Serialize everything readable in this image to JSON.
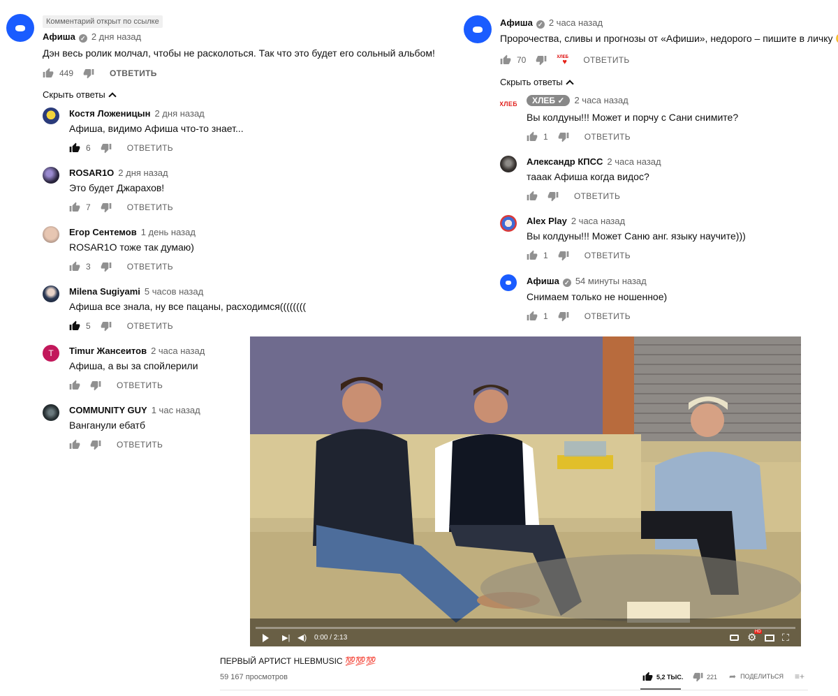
{
  "left": {
    "pinned_tag": "Комментарий открыт по ссылке",
    "main": {
      "author": "Афиша",
      "time": "2 дня назад",
      "text": "Дэн весь ролик молчал, чтобы не расколоться. Так что это будет его сольный альбом!",
      "likes": "449",
      "reply": "ОТВЕТИТЬ"
    },
    "hide_replies": "Скрыть ответы",
    "replies": [
      {
        "author": "Костя Ложеницын",
        "time": "2 дня назад",
        "text": "Афиша, видимо Афиша что-то знает...",
        "likes": "6",
        "reply": "ОТВЕТИТЬ"
      },
      {
        "author": "ROSAR1O",
        "time": "2 дня назад",
        "text": "Это будет Джарахов!",
        "likes": "7",
        "reply": "ОТВЕТИТЬ"
      },
      {
        "author": "Егор Сентемов",
        "time": "1 день назад",
        "text": "ROSAR1O тоже так думаю)",
        "likes": "3",
        "reply": "ОТВЕТИТЬ"
      },
      {
        "author": "Milena Sugiyami",
        "time": "5 часов назад",
        "text": "Афиша все знала, ну все пацаны, расходимся((((((((",
        "likes": "5",
        "reply": "ОТВЕТИТЬ"
      },
      {
        "author": "Timur Жансеитов",
        "time": "2 часа назад",
        "text": "Афиша, а вы за спойлерили",
        "likes": "",
        "reply": "ОТВЕТИТЬ",
        "avatar_letter": "T"
      },
      {
        "author": "COMMUNITY GUY",
        "time": "1 час назад",
        "text": "Ванганули ебатб",
        "likes": "",
        "reply": "ОТВЕТИТЬ"
      }
    ]
  },
  "right": {
    "main": {
      "author": "Афиша",
      "time": "2 часа назад",
      "text": "Пророчества, сливы и прогнозы от «Афиши», недорого – пишите в личку",
      "emoji": "🙂",
      "likes": "70",
      "reply": "ОТВЕТИТЬ",
      "hearted_by_logo": "ХЛЕБ"
    },
    "hide_replies": "Скрыть ответы",
    "replies": [
      {
        "author": "ХЛЕБ",
        "time": "2 часа назад",
        "text": "Вы колдуны!!! Может и порчу с Сани снимите?",
        "likes": "1",
        "reply": "ОТВЕТИТЬ",
        "owner": true,
        "avatar_text": "ХЛЕБ"
      },
      {
        "author": "Александр КПСС",
        "time": "2 часа назад",
        "text": "тааак Афиша когда видос?",
        "likes": "",
        "reply": "ОТВЕТИТЬ"
      },
      {
        "author": "Alex Play",
        "time": "2 часа назад",
        "text": "Вы колдуны!!! Может Саню анг. языку научите)))",
        "likes": "1",
        "reply": "ОТВЕТИТЬ"
      },
      {
        "author": "Афиша",
        "time": "54 минуты назад",
        "text": "Снимаем только не ношенное)",
        "likes": "1",
        "reply": "ОТВЕТИТЬ",
        "verified": true
      }
    ]
  },
  "video": {
    "time_display": "0:00 / 2:13",
    "title": "ПЕРВЫЙ АРТИСТ HLEBMUSIC",
    "title_emoji": "💯💯💯",
    "views": "59 167 просмотров",
    "likes": "5,2 ТЫС.",
    "dislikes": "221",
    "share_label": "ПОДЕЛИТЬСЯ",
    "hd_badge": "HD"
  }
}
